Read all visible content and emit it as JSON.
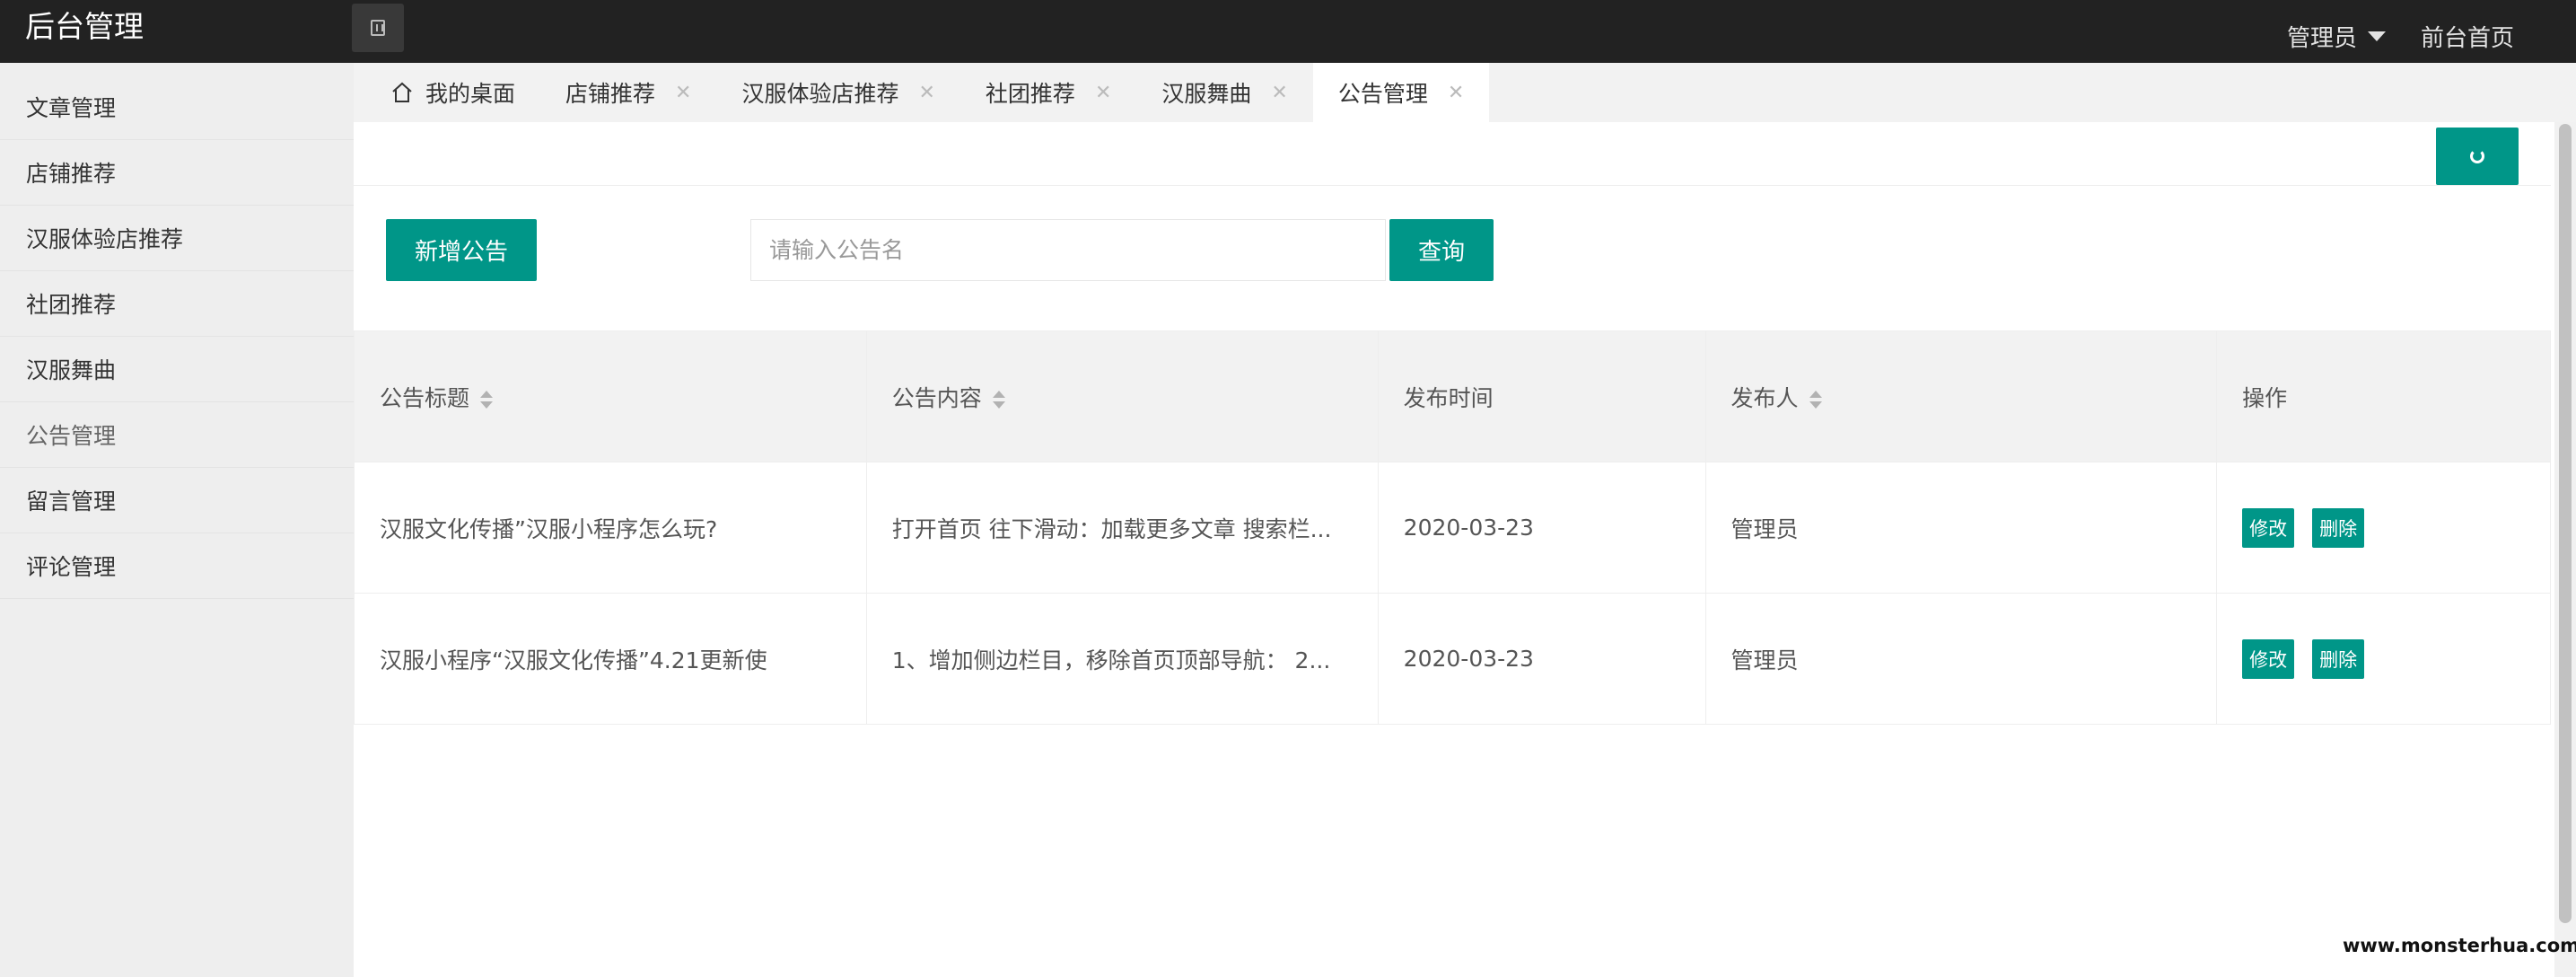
{
  "header": {
    "title": "后台管理",
    "user": "管理员",
    "front_link": "前台首页"
  },
  "sidebar": {
    "items": [
      {
        "label": "文章管理"
      },
      {
        "label": "店铺推荐"
      },
      {
        "label": "汉服体验店推荐"
      },
      {
        "label": "社团推荐"
      },
      {
        "label": "汉服舞曲"
      },
      {
        "label": "公告管理"
      },
      {
        "label": "留言管理"
      },
      {
        "label": "评论管理"
      }
    ]
  },
  "tabs": [
    {
      "label": "我的桌面"
    },
    {
      "label": "店铺推荐"
    },
    {
      "label": "汉服体验店推荐"
    },
    {
      "label": "社团推荐"
    },
    {
      "label": "汉服舞曲"
    },
    {
      "label": "公告管理"
    }
  ],
  "toolbar": {
    "add_label": "新增公告",
    "search_placeholder": "请输入公告名",
    "query_label": "查询"
  },
  "table": {
    "headers": [
      "公告标题",
      "公告内容",
      "发布时间",
      "发布人",
      "操作"
    ],
    "rows": [
      {
        "title": "汉服文化传播”汉服小程序怎么玩?",
        "content": "打开首页 往下滑动：加载更多文章 搜索栏...",
        "date": "2020-03-23",
        "author": "管理员",
        "edit": "修改",
        "delete": "删除"
      },
      {
        "title": "汉服小程序“汉服文化传播”4.21更新使",
        "content": "1、增加侧边栏目，移除首页顶部导航： 2...",
        "date": "2020-03-23",
        "author": "管理员",
        "edit": "修改",
        "delete": "删除"
      }
    ]
  },
  "watermark": "www.monsterhua.com",
  "colors": {
    "accent": "#009688",
    "header_bg": "#222222",
    "sidebar_bg": "#eeeeee"
  }
}
